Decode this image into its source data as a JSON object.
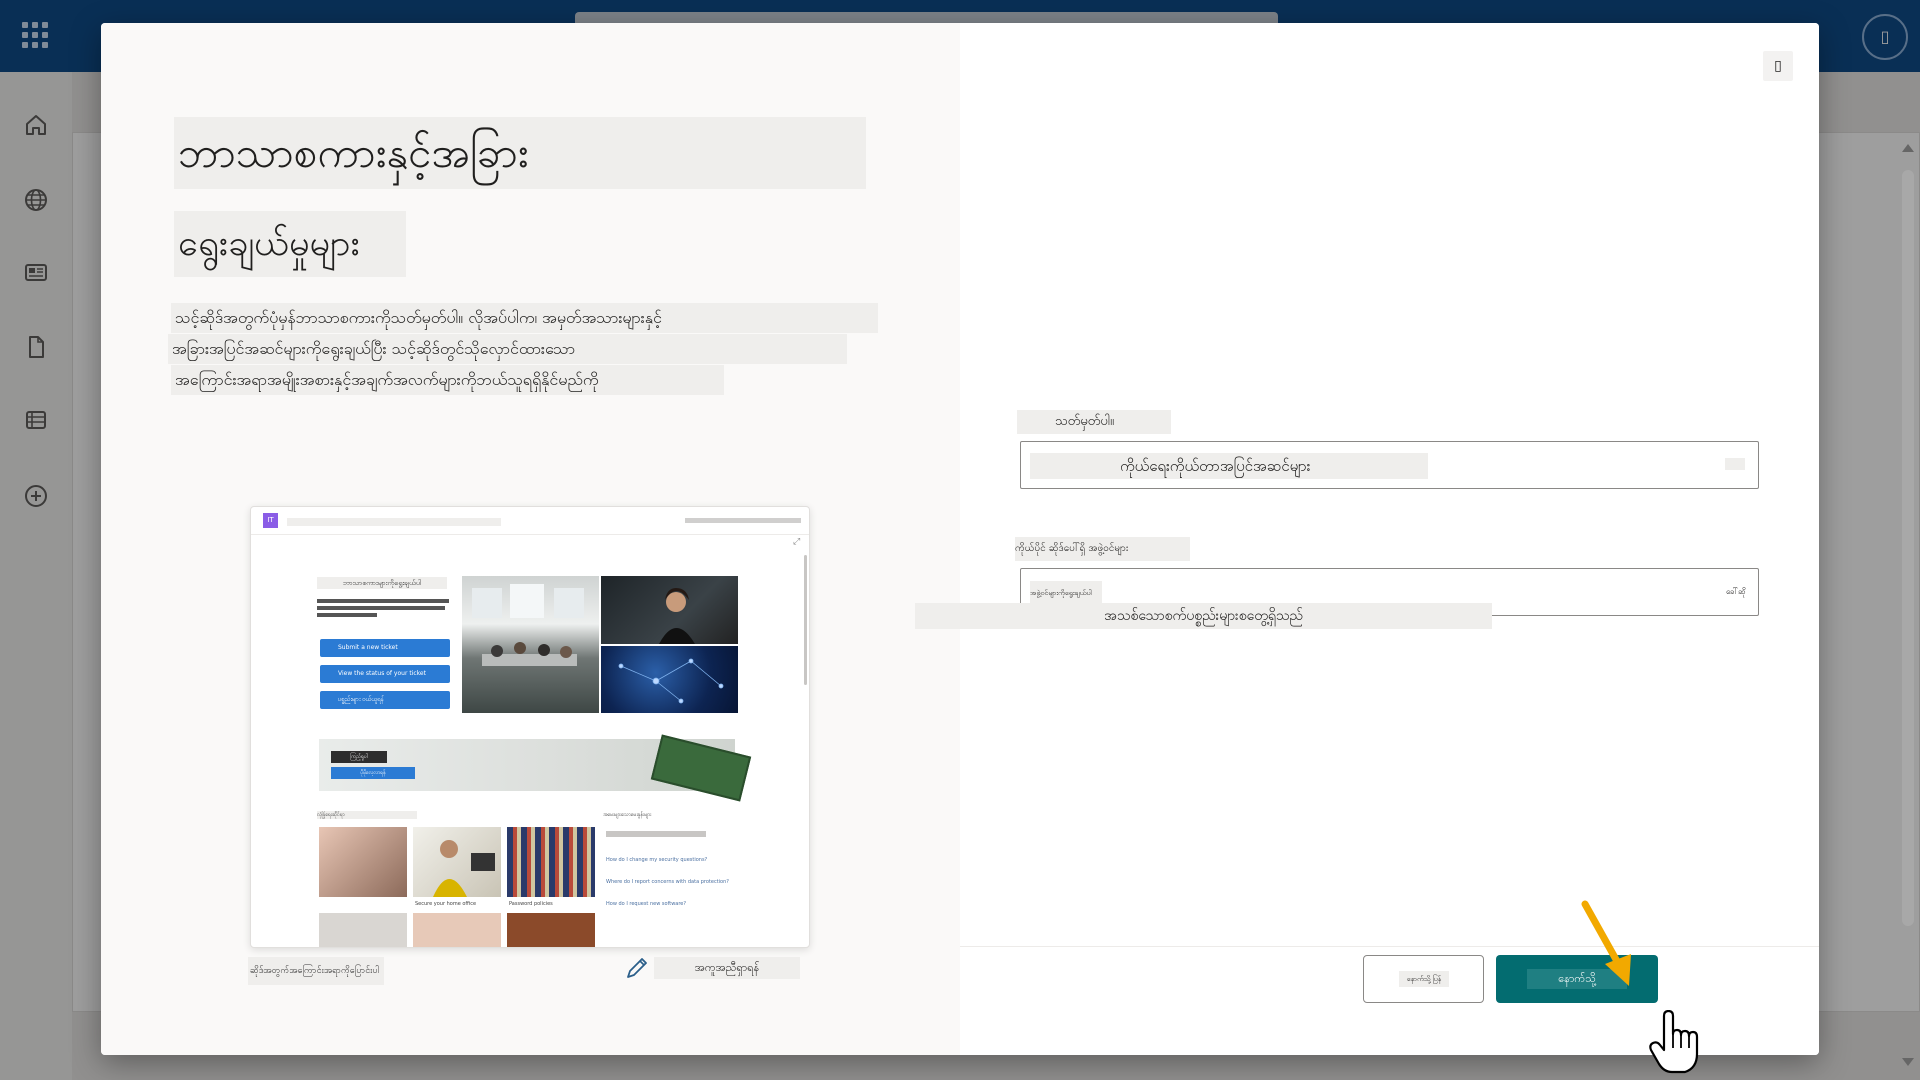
{
  "app": {
    "topbar_color": "#0f4c8a",
    "avatar_glyph": "▯",
    "left_rail_icons": [
      "home-icon",
      "globe-icon",
      "news-icon",
      "document-icon",
      "list-icon",
      "add-circle-icon"
    ]
  },
  "dialog": {
    "title": "ဘာသာစကားနှင့်အခြား",
    "subtitle": "ရွေးချယ်မှုများ",
    "description_lines": [
      "သင့်ဆိုဒ်အတွက်ပုံမှန်ဘာသာစကားကိုသတ်မှတ်ပါ။ လိုအပ်ပါက၊ အမှတ်အသားများနှင့်",
      "အခြားအပြင်အဆင်များကိုရွေးချယ်ပြီး သင့်ဆိုဒ်တွင်သိုလှောင်ထားသော",
      "အကြောင်းအရာအမျိုးအစားနှင့်အချက်အလက်များကိုဘယ်သူရရှိနိုင်မည်ကို"
    ],
    "close_glyph": "▯",
    "preview": {
      "logo_text": "IT",
      "heading": "ဘာသာစကားများကိုရွေးချယ်ပါ",
      "buttons": [
        "Submit a new ticket",
        "View the status of your ticket",
        "ပစ္စည်းများ ဝယ်ယူရန်"
      ],
      "banner_chip": "ကြည့်ရှုပါ",
      "banner_button": "ပိုမိုလေ့လာရန်",
      "section_title": "လုံခြုံရေးဆိုင်ရာ",
      "tiles": [
        "",
        "Secure your home office",
        "Password policies"
      ],
      "faq_title": "အမေးများသောမေးခွန်းများ",
      "faq_items": [
        "How do I change my security questions?",
        "Where do I report concerns with data protection?",
        "How do I request new software?"
      ]
    },
    "footer_note": "ဆိုဒ်အတွက်အကြောင်းအရာကိုပြောင်းပါ",
    "edit_link": "အကူအညီရှာရန်"
  },
  "form": {
    "field1_label": "သတ်မှတ်ပါ။",
    "field1_value": "ကိုယ်ရေးကိုယ်တာအပြင်အဆင်များ",
    "field2_label": "ကိုယ်ပိုင် ဆိုဒ်ပေါ်ရှိ အဖွဲ့ဝင်များ",
    "field2_value": "အဖွဲ့ဝင်များကိုရွေးချယ်ပါ",
    "field2_end": "ခေါ်ဆို",
    "results_text": "အသစ်သောစက်ပစ္စည်းများစတွေ့ရှိသည်",
    "back_button": "နောက်သို့ပြန်",
    "next_button": "နောက်သို့"
  },
  "colors": {
    "primary_button": "#036c70",
    "callout_arrow": "#f2a900",
    "link_blue": "#2b7bd4"
  }
}
